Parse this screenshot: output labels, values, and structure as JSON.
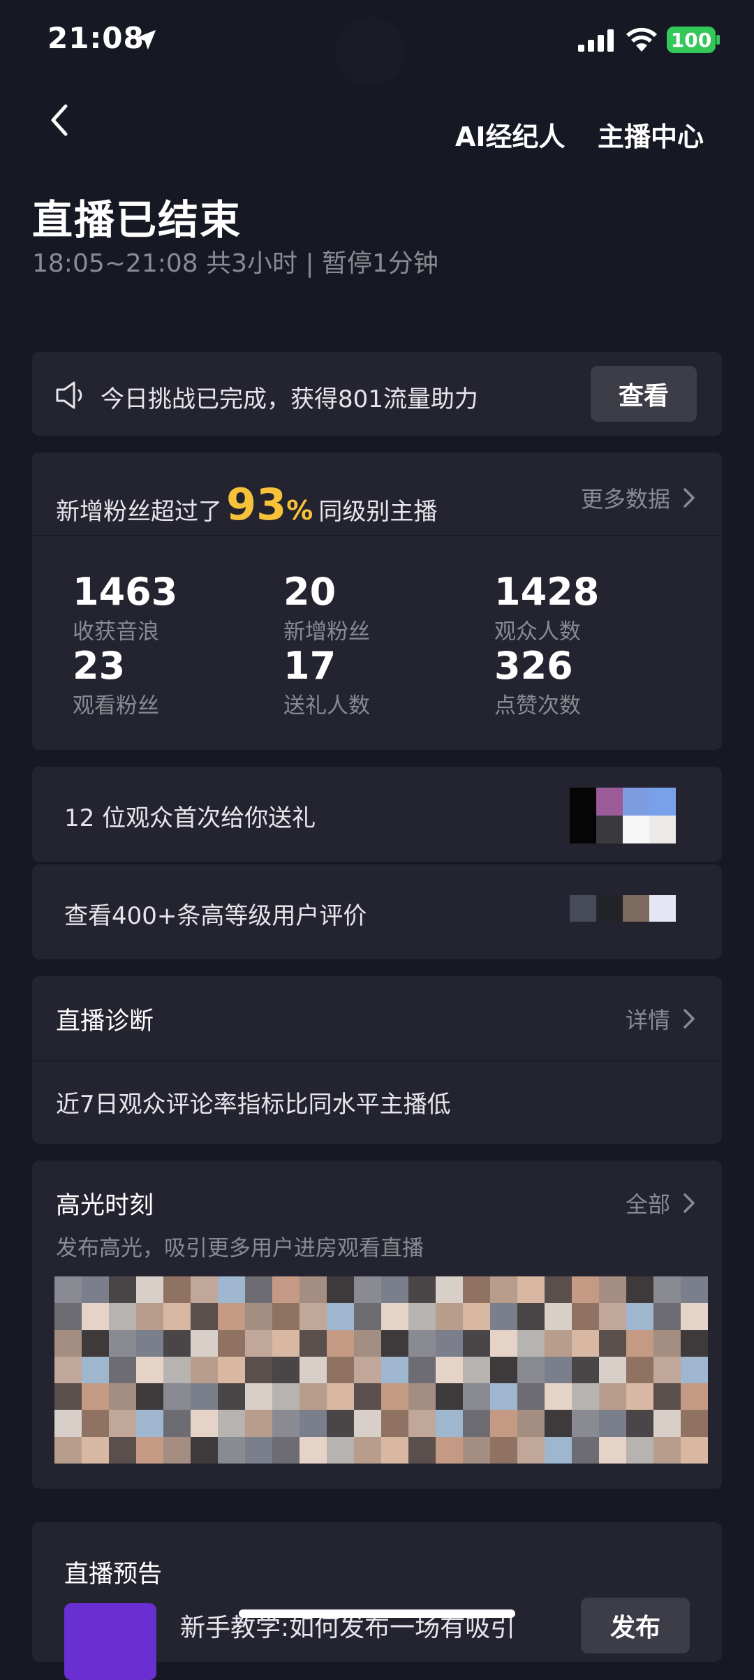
{
  "status_bar": {
    "time": "21:08",
    "battery": "100"
  },
  "header": {
    "links": [
      "AI经纪人",
      "主播中心"
    ],
    "title": "直播已结束",
    "subtitle": "18:05~21:08 共3小时 | 暂停1分钟"
  },
  "challenge": {
    "text": "今日挑战已完成，获得801流量助力",
    "button": "查看"
  },
  "fans_banner": {
    "prefix": "新增粉丝超过了",
    "percent": "93",
    "percent_sign": "%",
    "suffix": "同级别主播",
    "more_label": "更多数据"
  },
  "stats": [
    {
      "value": "1463",
      "label": "收获音浪"
    },
    {
      "value": "20",
      "label": "新增粉丝"
    },
    {
      "value": "1428",
      "label": "观众人数"
    },
    {
      "value": "23",
      "label": "观看粉丝"
    },
    {
      "value": "17",
      "label": "送礼人数"
    },
    {
      "value": "326",
      "label": "点赞次数"
    }
  ],
  "gift_row": {
    "text": "12 位观众首次给你送礼"
  },
  "review_row": {
    "text": "查看400+条高等级用户评价"
  },
  "diagnosis": {
    "title": "直播诊断",
    "link": "详情",
    "message": "近7日观众评论率指标比同水平主播低"
  },
  "highlights": {
    "title": "高光时刻",
    "link": "全部",
    "desc": "发布高光，吸引更多用户进房观看直播"
  },
  "preview": {
    "title": "直播预告",
    "item_text": "新手教学:如何发布一场有吸引",
    "button": "发布"
  },
  "colors": {
    "background": "#161823",
    "card": "#232430",
    "accent": "#f7c23a",
    "battery": "#34c759",
    "muted": "#8a8b91"
  },
  "icons": [
    "location-arrow-icon",
    "signal-icon",
    "wifi-icon",
    "battery-icon",
    "back-chevron-icon",
    "speaker-icon",
    "chevron-right-icon"
  ]
}
